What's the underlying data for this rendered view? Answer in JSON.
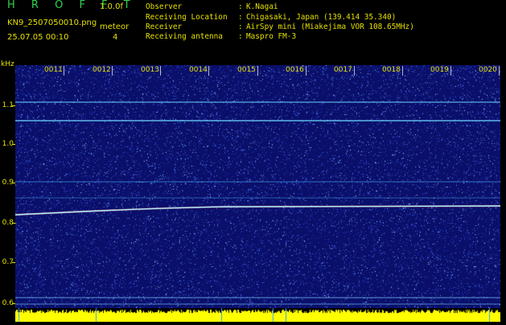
{
  "header": {
    "app_title": "H R O F F T",
    "version": "1.0.0f",
    "filename": "KN9_2507050010.png",
    "mode": "meteor",
    "datetime": "25.07.05 00:10",
    "param": "4",
    "fields": [
      {
        "label": "Observer",
        "value": "K.Nagai"
      },
      {
        "label": "Receiving Location",
        "value": "Chigasaki, Japan (139.414 35.340)"
      },
      {
        "label": "Receiver",
        "value": "AirSpy mini (Miakejima VOR 108.65MHz)"
      },
      {
        "label": "Receiving antenna",
        "value": "Maspro FM-3"
      }
    ],
    "separator": ":"
  },
  "plot": {
    "y_unit": "kHz",
    "y_ticks": [
      "1.1",
      "1.0",
      "0.9",
      "0.8",
      "0.7",
      "0.6"
    ],
    "x_ticks": [
      "0011",
      "0012",
      "0013",
      "0014",
      "0015",
      "0016",
      "0017",
      "0018",
      "0019",
      "0020"
    ],
    "colors": {
      "background": "#0a0f6a",
      "text": "#e6e000",
      "signal": "#7fe0ff",
      "power_bar": "#ffff00"
    }
  }
}
